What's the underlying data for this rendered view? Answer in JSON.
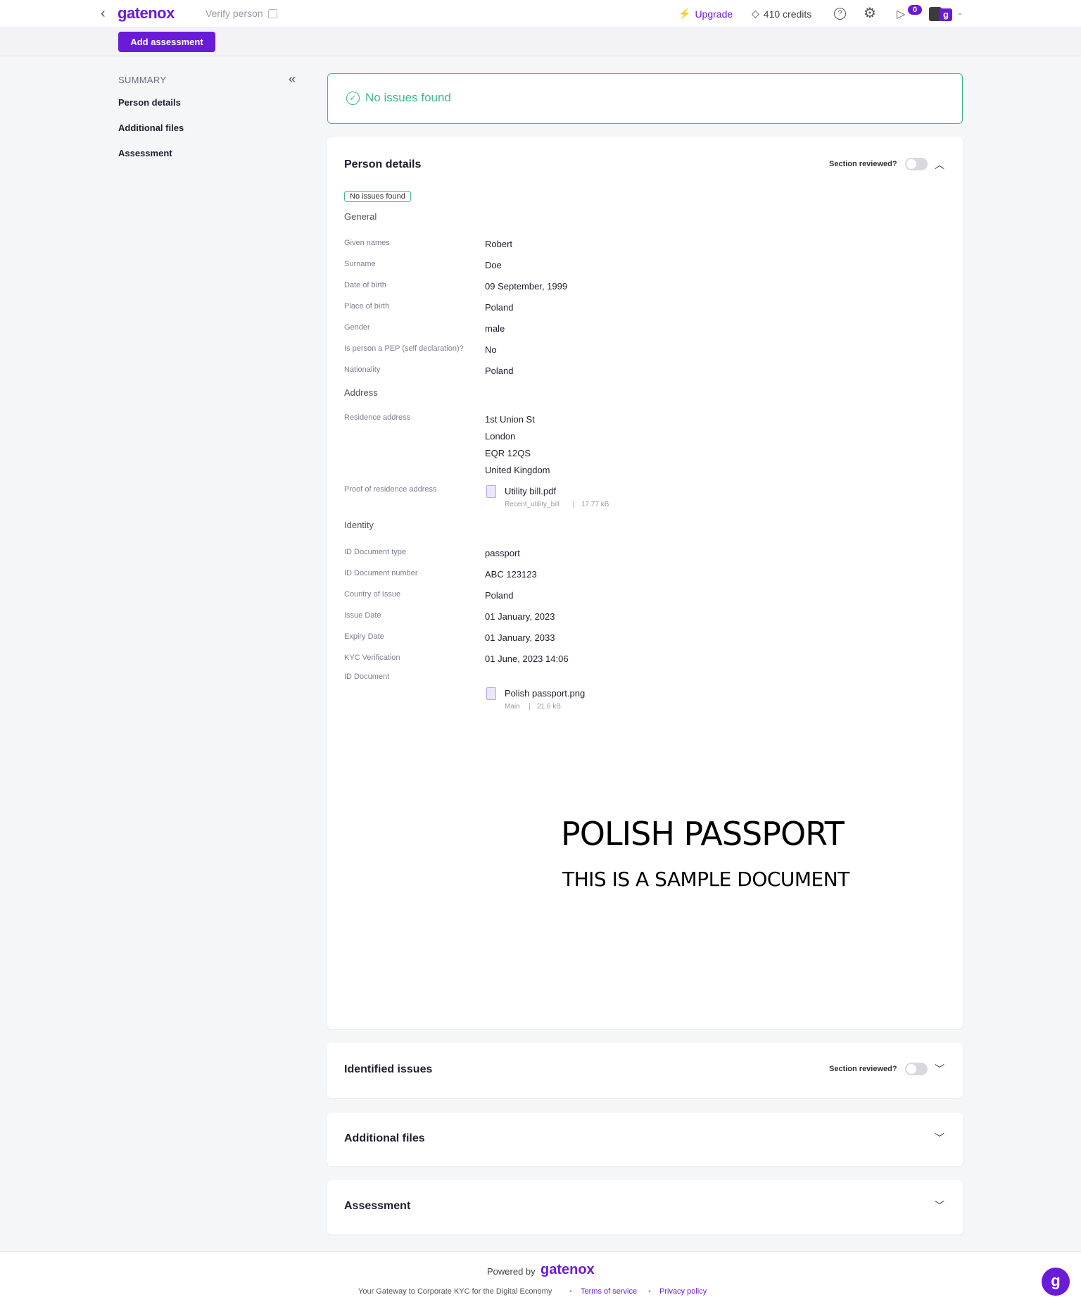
{
  "header": {
    "logo": "gatenox",
    "verify_label": "Verify person",
    "upgrade_label": "Upgrade",
    "credits_label": "410 credits",
    "help_symbol": "?",
    "notifications_count": "0",
    "avatar_letter": "g"
  },
  "toolbar": {
    "add_assessment_label": "Add assessment"
  },
  "sidebar": {
    "summary_title": "SUMMARY",
    "items": [
      {
        "label": "Person details"
      },
      {
        "label": "Additional files"
      },
      {
        "label": "Assessment"
      }
    ]
  },
  "banner": {
    "text": "No issues found"
  },
  "person_details": {
    "title": "Person details",
    "reviewed_label": "Section reviewed?",
    "status_pill": "No issues found",
    "general": {
      "heading": "General",
      "rows": [
        {
          "label": "Given names",
          "value": "Robert"
        },
        {
          "label": "Surname",
          "value": "Doe"
        },
        {
          "label": "Date of birth",
          "value": "09 September, 1999"
        },
        {
          "label": "Place of birth",
          "value": "Poland"
        },
        {
          "label": "Gender",
          "value": "male"
        },
        {
          "label": "Is person a PEP (self declaration)?",
          "value": "No"
        },
        {
          "label": "Nationality",
          "value": "Poland"
        }
      ]
    },
    "address": {
      "heading": "Address",
      "residence_label": "Residence address",
      "residence_lines": [
        "1st Union St",
        "London",
        "EQR 12QS",
        "United Kingdom"
      ],
      "proof_label": "Proof of residence address",
      "proof_file": {
        "name": "Utility bill.pdf",
        "type": "Recent_utility_bill",
        "size": "17.77 kB"
      }
    },
    "identity": {
      "heading": "Identity",
      "rows": [
        {
          "label": "ID Document type",
          "value": "passport"
        },
        {
          "label": "ID Document number",
          "value": "ABC 123123"
        },
        {
          "label": "Country of Issue",
          "value": "Poland"
        },
        {
          "label": "Issue Date",
          "value": "01 January, 2023"
        },
        {
          "label": "Expiry Date",
          "value": "01 January, 2033"
        },
        {
          "label": "KYC Verification",
          "value": "01 June, 2023 14:06"
        }
      ],
      "doc_label": "ID Document",
      "doc_file": {
        "name": "Polish passport.png",
        "type": "Main",
        "size": "21.6 kB"
      },
      "preview_title": "POLISH PASSPORT",
      "preview_subtitle": "THIS IS A SAMPLE DOCUMENT"
    }
  },
  "identified_issues": {
    "title": "Identified issues",
    "reviewed_label": "Section reviewed?"
  },
  "additional_files": {
    "title": "Additional files"
  },
  "assessment": {
    "title": "Assessment"
  },
  "footer": {
    "powered_by": "Powered by",
    "logo": "gatenox",
    "tagline": "Your Gateway to Corporate KYC for the Digital Economy",
    "terms": "Terms of service",
    "privacy": "Privacy policy"
  },
  "colors": {
    "accent": "#6a1bd8",
    "success": "#3db98a"
  }
}
